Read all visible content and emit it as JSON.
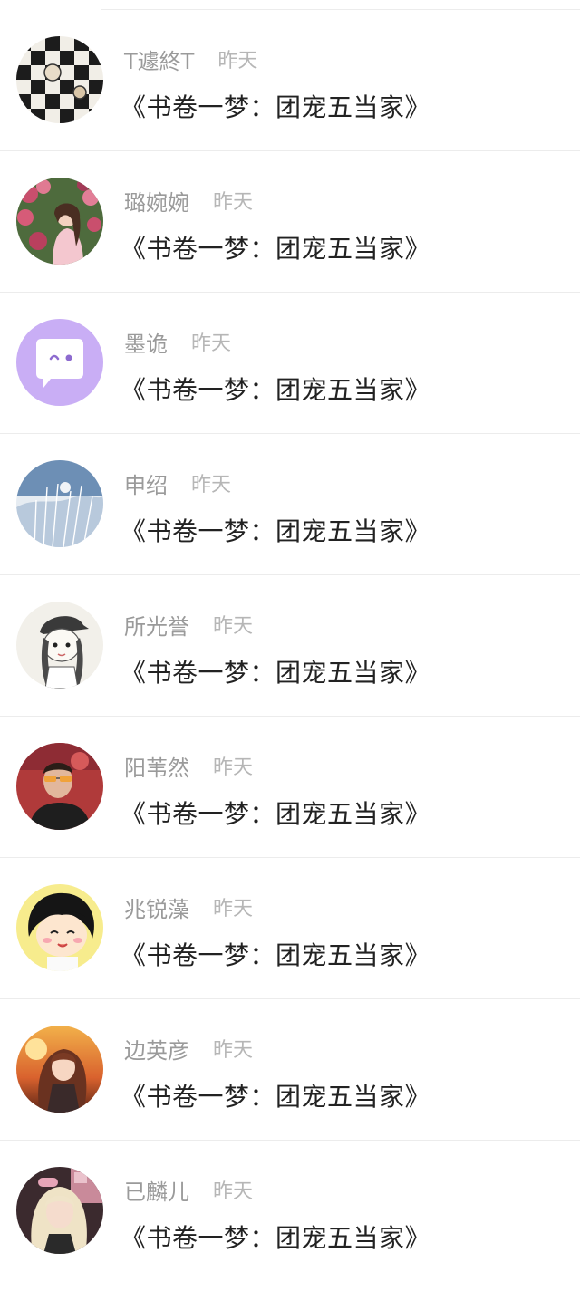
{
  "rows": [
    {
      "name": "T遽終T",
      "time": "昨天",
      "message": "《书卷一梦：团宠五当家》",
      "avatar": "checkerboard-collage-avatar"
    },
    {
      "name": "璐婉婉",
      "time": "昨天",
      "message": "《书卷一梦：团宠五当家》",
      "avatar": "girl-with-roses-avatar"
    },
    {
      "name": "墨诡",
      "time": "昨天",
      "message": "《书卷一梦：团宠五当家》",
      "avatar": "purple-chat-bubble-avatar"
    },
    {
      "name": "申绍",
      "time": "昨天",
      "message": "《书卷一梦：团宠五当家》",
      "avatar": "blue-sketch-avatar"
    },
    {
      "name": "所光誉",
      "time": "昨天",
      "message": "《书卷一梦：团宠五当家》",
      "avatar": "sketch-cap-girl-avatar"
    },
    {
      "name": "阳苇然",
      "time": "昨天",
      "message": "《书卷一梦：团宠五当家》",
      "avatar": "man-sunglasses-avatar"
    },
    {
      "name": "兆锐藻",
      "time": "昨天",
      "message": "《书卷一梦：团宠五当家》",
      "avatar": "cartoon-girl-avatar"
    },
    {
      "name": "边英彦",
      "time": "昨天",
      "message": "《书卷一梦：团宠五当家》",
      "avatar": "anime-girl-sunset-avatar"
    },
    {
      "name": "已麟儿",
      "time": "昨天",
      "message": "《书卷一梦：团宠五当家》",
      "avatar": "blonde-girl-avatar"
    }
  ],
  "colors": {
    "name": "#9a9a9a",
    "time": "#b6b6b6",
    "message": "#222222",
    "divider": "#ececec",
    "chat_bubble_bg": "#c9aef5"
  }
}
